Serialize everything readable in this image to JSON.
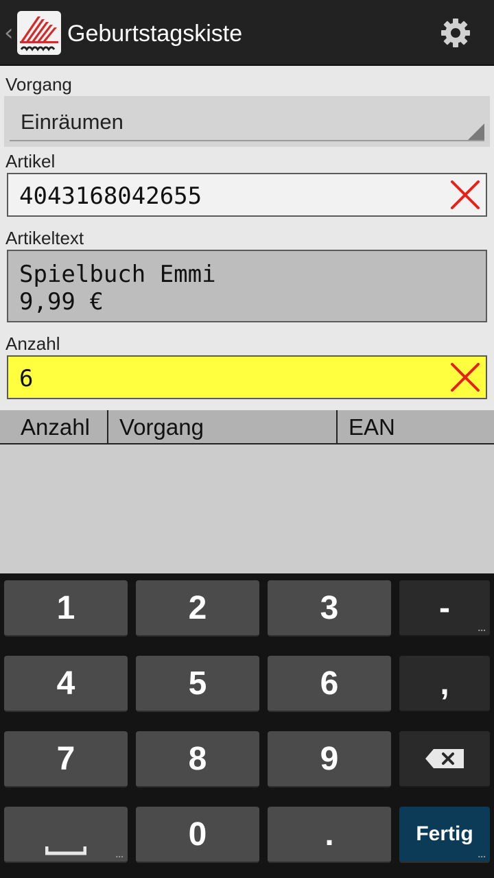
{
  "action_bar": {
    "title": "Geburtstagskiste",
    "icons": [
      "up-caret-icon",
      "app-logo-icon",
      "settings-gear-icon"
    ]
  },
  "form": {
    "vorgang": {
      "label": "Vorgang",
      "selected": "Einräumen"
    },
    "artikel": {
      "label": "Artikel",
      "value": "4043168042655"
    },
    "artikeltext": {
      "label": "Artikeltext",
      "line1": "Spielbuch Emmi",
      "line2": "9,99 €"
    },
    "anzahl": {
      "label": "Anzahl",
      "value": "6"
    }
  },
  "table": {
    "columns": [
      "Anzahl",
      "Vorgang",
      "EAN"
    ],
    "rows": []
  },
  "keyboard": {
    "rows": [
      [
        "1",
        "2",
        "3",
        "-"
      ],
      [
        "4",
        "5",
        "6",
        ","
      ],
      [
        "7",
        "8",
        "9",
        "backspace"
      ],
      [
        "space",
        "0",
        ".",
        "Fertig"
      ]
    ],
    "done_label": "Fertig"
  },
  "colors": {
    "action_bar": "#222222",
    "highlight_field": "#ffff40",
    "clear_icon": "#e8201a",
    "done_key": "#0b3b57"
  }
}
